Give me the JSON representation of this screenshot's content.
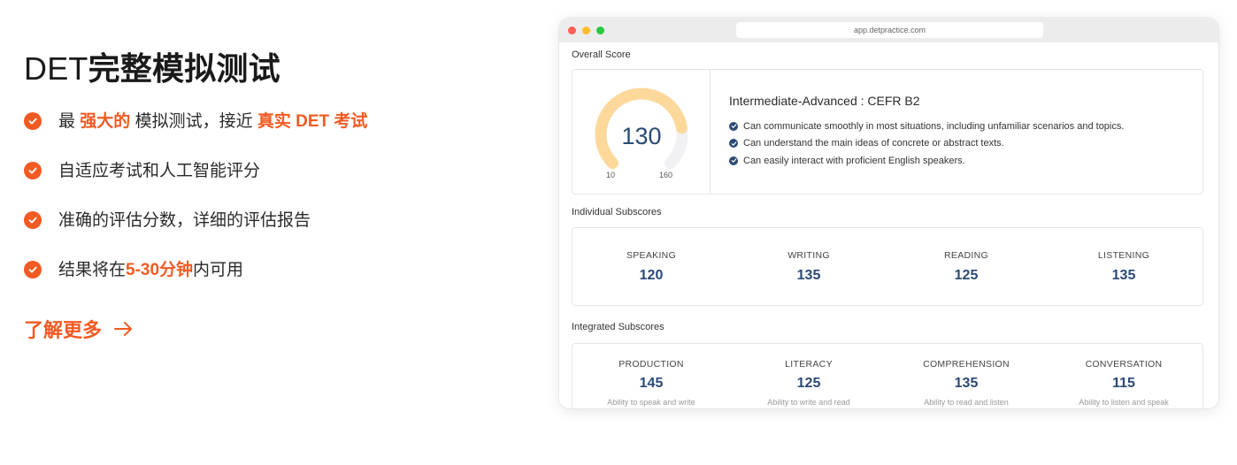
{
  "hero": {
    "title_prefix": "DET",
    "title_bold": "完整模拟测试",
    "features": [
      {
        "parts": [
          {
            "t": "最 ",
            "hl": false
          },
          {
            "t": "强大的",
            "hl": true
          },
          {
            "t": " 模拟测试，接近 ",
            "hl": false
          },
          {
            "t": "真实 DET 考试",
            "hl": true
          }
        ]
      },
      {
        "parts": [
          {
            "t": "自适应考试和人工智能评分",
            "hl": false
          }
        ]
      },
      {
        "parts": [
          {
            "t": "准确的评估分数，详细的评估报告",
            "hl": false
          }
        ]
      },
      {
        "parts": [
          {
            "t": "结果将在",
            "hl": false
          },
          {
            "t": "5-30分钟",
            "hl": true
          },
          {
            "t": "内可用",
            "hl": false
          }
        ]
      }
    ],
    "learn_more": "了解更多"
  },
  "browser": {
    "url": "app.detpractice.com",
    "overall": {
      "section_title": "Overall Score",
      "score": "130",
      "score_value": 130,
      "min": "10",
      "max": "160",
      "min_value": 10,
      "max_value": 160,
      "level": "Intermediate-Advanced : CEFR B2",
      "bullets": [
        "Can communicate smoothly in most situations, including unfamiliar scenarios and topics.",
        "Can understand the main ideas of concrete or abstract texts.",
        "Can easily interact with proficient English speakers."
      ]
    },
    "individual": {
      "section_title": "Individual Subscores",
      "items": [
        {
          "label": "SPEAKING",
          "value": "120"
        },
        {
          "label": "WRITING",
          "value": "135"
        },
        {
          "label": "READING",
          "value": "125"
        },
        {
          "label": "LISTENING",
          "value": "135"
        }
      ]
    },
    "integrated": {
      "section_title": "Integrated Subscores",
      "items": [
        {
          "label": "PRODUCTION",
          "value": "145",
          "desc": "Ability to speak and write"
        },
        {
          "label": "LITERACY",
          "value": "125",
          "desc": "Ability to write and read"
        },
        {
          "label": "COMPREHENSION",
          "value": "135",
          "desc": "Ability to read and listen"
        },
        {
          "label": "CONVERSATION",
          "value": "115",
          "desc": "Ability to listen and speak"
        }
      ]
    }
  },
  "colors": {
    "accent": "#f25a23",
    "score_blue": "#2b4a75",
    "gauge_fill": "#fcd89a",
    "gauge_track": "#f1f1f3"
  },
  "icons": {
    "feature_bullet": "check-circle-icon",
    "learn_more": "arrow-right-icon",
    "level_bullet": "check-circle-icon"
  }
}
